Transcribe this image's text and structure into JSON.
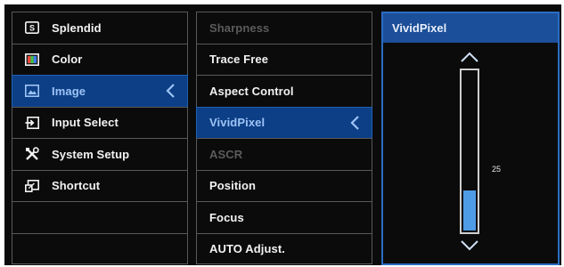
{
  "main_menu": {
    "items": [
      {
        "label": "Splendid",
        "icon": "splendid-icon",
        "selected": false
      },
      {
        "label": "Color",
        "icon": "color-icon",
        "selected": false
      },
      {
        "label": "Image",
        "icon": "image-icon",
        "selected": true
      },
      {
        "label": "Input Select",
        "icon": "input-select-icon",
        "selected": false
      },
      {
        "label": "System Setup",
        "icon": "system-setup-icon",
        "selected": false
      },
      {
        "label": "Shortcut",
        "icon": "shortcut-icon",
        "selected": false
      },
      {
        "label": "",
        "icon": "",
        "selected": false
      },
      {
        "label": "",
        "icon": "",
        "selected": false
      }
    ]
  },
  "sub_menu": {
    "items": [
      {
        "label": "Sharpness",
        "state": "disabled"
      },
      {
        "label": "Trace Free",
        "state": "normal"
      },
      {
        "label": "Aspect Control",
        "state": "normal"
      },
      {
        "label": "VividPixel",
        "state": "selected"
      },
      {
        "label": "ASCR",
        "state": "disabled"
      },
      {
        "label": "Position",
        "state": "normal"
      },
      {
        "label": "Focus",
        "state": "normal"
      },
      {
        "label": "AUTO Adjust.",
        "state": "normal"
      }
    ]
  },
  "panel": {
    "title": "VividPixel",
    "value": "25",
    "level_fraction": 0.25
  },
  "colors": {
    "osd_background": "#0b0b0b",
    "selected_row": "#0d3f86",
    "panel_header": "#1c4f99",
    "panel_border": "#2a6cc4",
    "slider_fill": "#4f9be6"
  }
}
